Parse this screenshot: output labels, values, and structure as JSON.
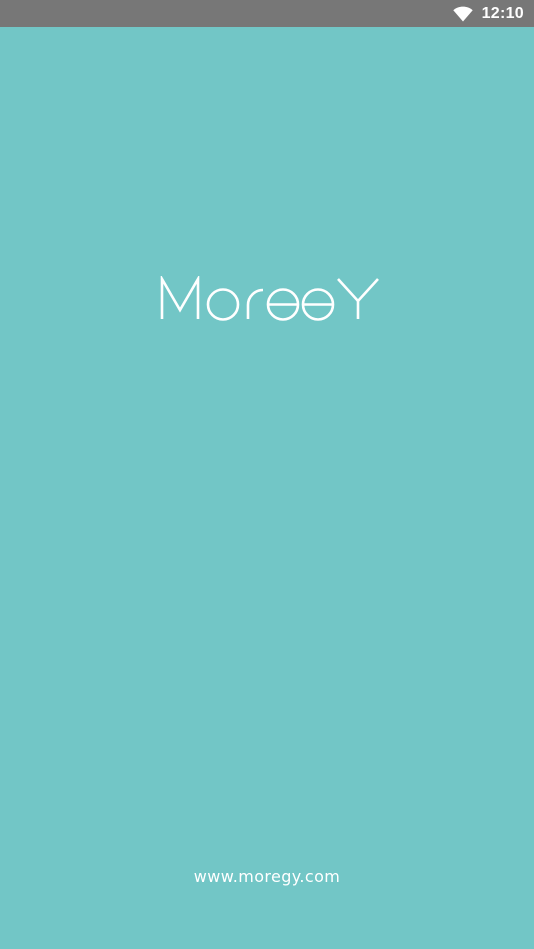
{
  "status_bar": {
    "time": "12:10",
    "icons": [
      "wifi-icon"
    ]
  },
  "splash": {
    "brand_logo_text": "MOREGY",
    "website_url": "www.moregy.com"
  },
  "colors": {
    "background": "#72c6c6",
    "status_bar": "#777777",
    "foreground": "#ffffff"
  }
}
